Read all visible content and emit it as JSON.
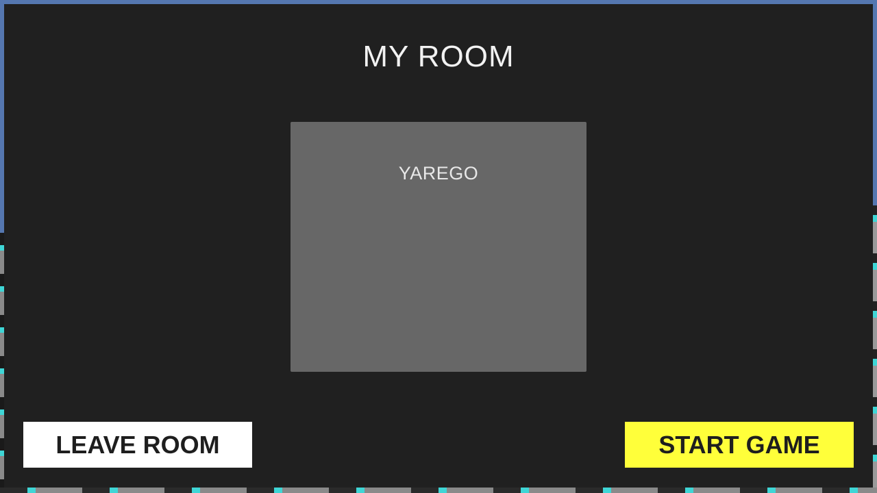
{
  "room": {
    "title": "MY ROOM"
  },
  "players": [
    {
      "name": "YAREGO"
    }
  ],
  "buttons": {
    "leave_label": "LEAVE ROOM",
    "start_label": "START GAME"
  },
  "colors": {
    "panel": "#202020",
    "player_box": "#676767",
    "leave_button": "#ffffff",
    "start_button": "#ffff3a"
  }
}
